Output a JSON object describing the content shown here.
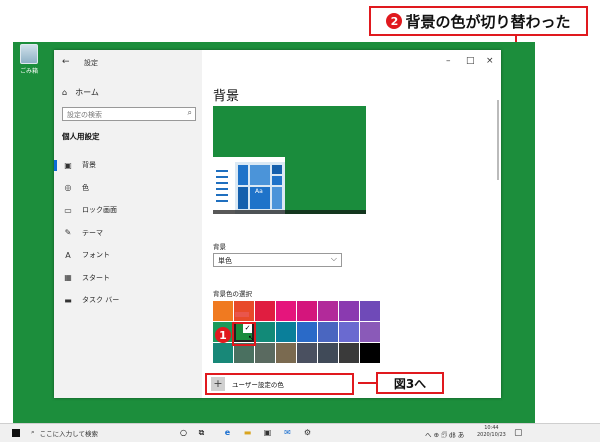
{
  "callouts": {
    "top_number": "2",
    "top_text": "背景の色が切り替わった",
    "item_number": "1",
    "figure_ref": "図3へ"
  },
  "desktop": {
    "background_color": "#1c8e3c",
    "recycle_bin_label": "ごみ箱"
  },
  "window": {
    "title": "設定",
    "back_icon": "←",
    "controls": {
      "minimize": "–",
      "maximize": "□",
      "close": "×"
    }
  },
  "nav": {
    "home_label": "ホーム",
    "search_placeholder": "設定の検索",
    "section_title": "個人用設定",
    "items": [
      {
        "icon": "picture-icon",
        "glyph": "▣",
        "label": "背景",
        "selected": true
      },
      {
        "icon": "palette-icon",
        "glyph": "◎",
        "label": "色",
        "selected": false
      },
      {
        "icon": "lock-screen-icon",
        "glyph": "▭",
        "label": "ロック画面",
        "selected": false
      },
      {
        "icon": "theme-icon",
        "glyph": "✎",
        "label": "テーマ",
        "selected": false
      },
      {
        "icon": "font-icon",
        "glyph": "A",
        "label": "フォント",
        "selected": false
      },
      {
        "icon": "start-icon",
        "glyph": "▦",
        "label": "スタート",
        "selected": false
      },
      {
        "icon": "taskbar-icon",
        "glyph": "▬",
        "label": "タスク バー",
        "selected": false
      }
    ]
  },
  "content": {
    "heading": "背景",
    "background_label": "背景",
    "background_value": "単色",
    "color_section_label": "背景色の選択",
    "custom_color_label": "ユーザー設定の色",
    "preview_text": "Aa",
    "selected_swatch_index": 9,
    "swatches": [
      "#f07a20",
      "#e84a2a",
      "#e01d40",
      "#e5157c",
      "#d4157c",
      "#b22a9a",
      "#8a3ab0",
      "#6f4ab8",
      "#1a9a5a",
      "#1a8c3c",
      "#128a78",
      "#0a7f9a",
      "#2a6ac8",
      "#4a66c0",
      "#6a6ad0",
      "#8a5ab8",
      "#188878",
      "#4a7060",
      "#5a6a60",
      "#7a6a50",
      "#4a5060",
      "#404a58",
      "#3a3a3a",
      "#000000"
    ]
  },
  "taskbar": {
    "search_placeholder": "ここに入力して検索",
    "apps": [
      "cortana-icon",
      "task-view-icon",
      "edge-icon",
      "explorer-icon",
      "store-icon",
      "mail-icon",
      "settings-icon"
    ],
    "tray_text": "へ ⊕ 🗊 ㏈ あ",
    "time": "10:44",
    "date": "2020/10/23"
  }
}
